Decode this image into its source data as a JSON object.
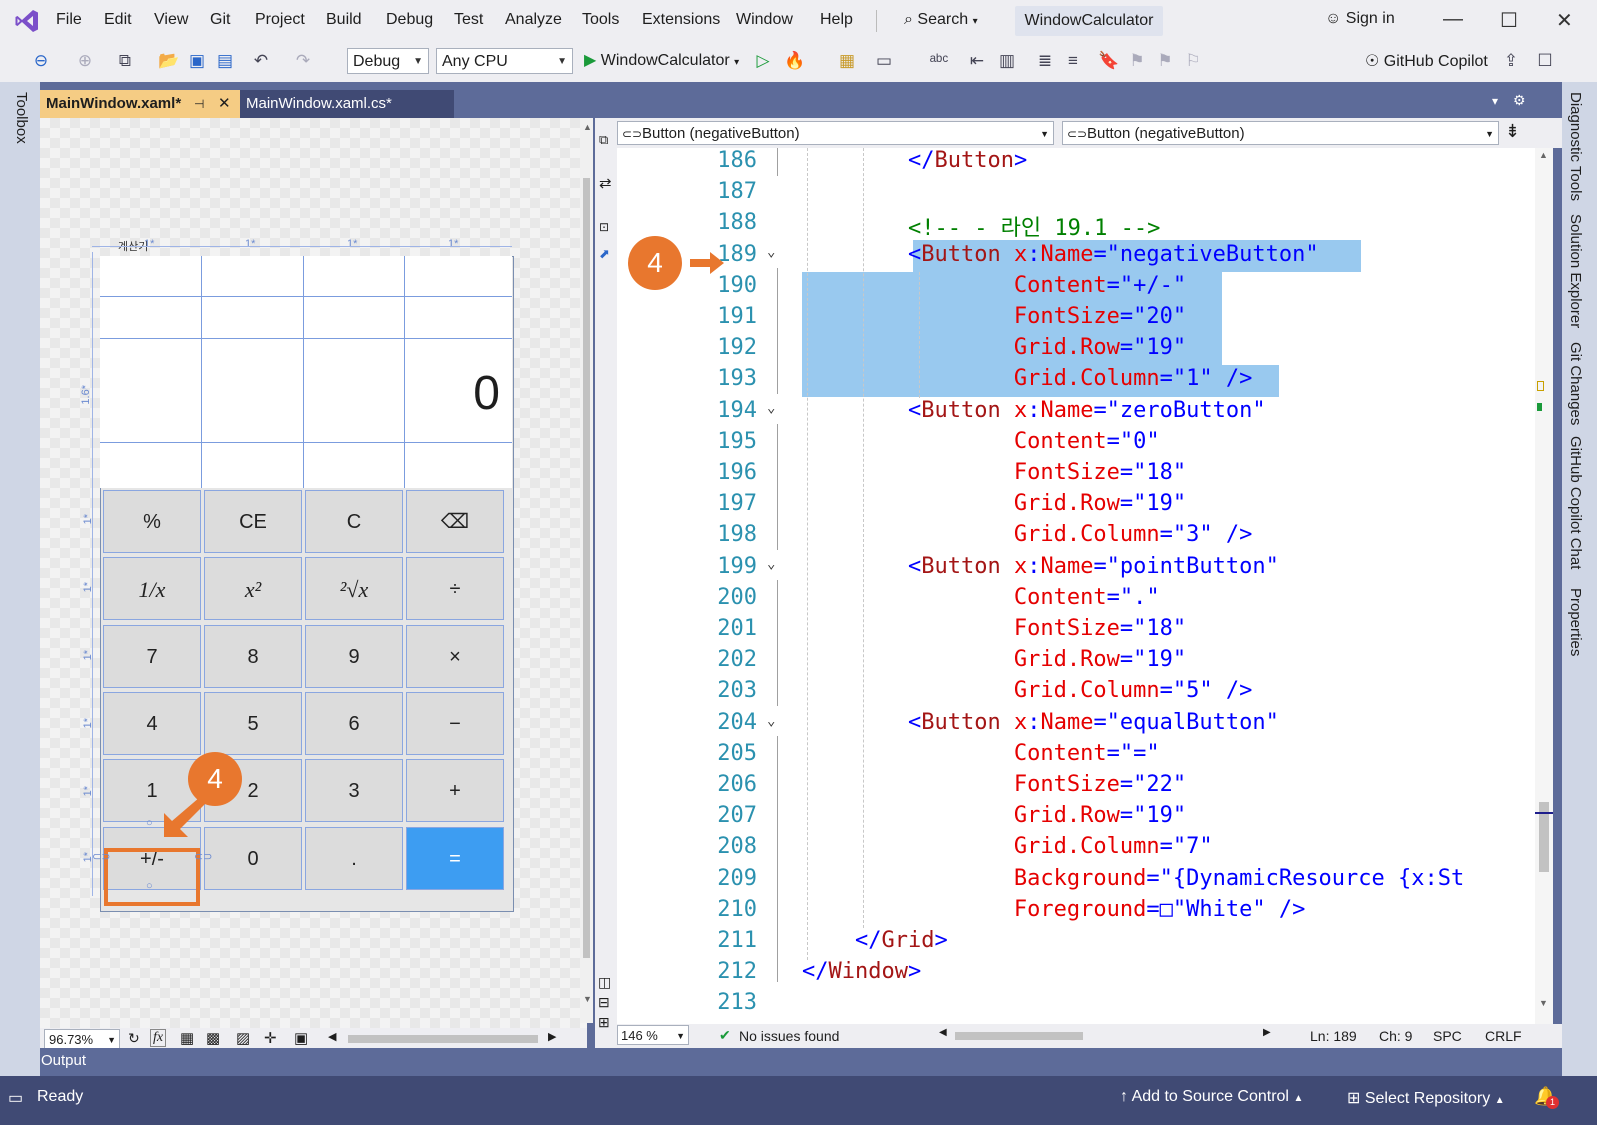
{
  "menu": [
    "File",
    "Edit",
    "View",
    "Git",
    "Project",
    "Build",
    "Debug",
    "Test",
    "Analyze",
    "Tools",
    "Extensions",
    "Window",
    "Help"
  ],
  "search_label": "Search",
  "app_title": "WindowCalculator",
  "sign_in": "Sign in",
  "toolbar": {
    "config": "Debug",
    "platform": "Any CPU",
    "start_target": "WindowCalculator",
    "copilot": "GitHub Copilot"
  },
  "side_tabs": {
    "left": "Toolbox",
    "right": [
      "Diagnostic Tools",
      "Solution Explorer",
      "Git Changes",
      "GitHub Copilot Chat",
      "Properties"
    ]
  },
  "doc_tabs": [
    {
      "label": "MainWindow.xaml*",
      "active": true
    },
    {
      "label": "MainWindow.xaml.cs*",
      "active": false
    }
  ],
  "designer": {
    "window_title": "계산기",
    "col_labels": [
      "1*",
      "1*",
      "1*",
      "1*"
    ],
    "row_labels": [
      "1.6*",
      "1*",
      "1*",
      "1*",
      "1*",
      "1*",
      "1*"
    ],
    "display_value": "0",
    "buttons": [
      [
        "%",
        "CE",
        "C",
        "⌫"
      ],
      [
        "1/x",
        "x²",
        "²√x",
        "÷"
      ],
      [
        "7",
        "8",
        "9",
        "×"
      ],
      [
        "4",
        "5",
        "6",
        "−"
      ],
      [
        "1",
        "2",
        "3",
        "+"
      ],
      [
        "+/-",
        "0",
        ".",
        "="
      ]
    ],
    "zoom": "96.73%",
    "fx_label": "fx"
  },
  "nav_bar": {
    "left": "Button (negativeButton)",
    "right": "Button (negativeButton)"
  },
  "code_lines": [
    {
      "n": "186",
      "parts": [
        [
          "blue",
          "</"
        ],
        [
          "brown",
          "Button"
        ],
        [
          "blue",
          ">"
        ]
      ],
      "indent": "        "
    },
    {
      "n": "187",
      "parts": [],
      "indent": ""
    },
    {
      "n": "188",
      "parts": [
        [
          "green",
          "<!-- - 라인 19.1 -->"
        ]
      ],
      "indent": "        "
    },
    {
      "n": "189",
      "parts": [
        [
          "blue",
          "<"
        ],
        [
          "brown",
          "Button"
        ],
        [
          "red",
          " x"
        ],
        [
          "blue",
          ":"
        ],
        [
          "red",
          "Name"
        ],
        [
          "blue",
          "=\"negativeButton\""
        ]
      ],
      "indent": "        "
    },
    {
      "n": "190",
      "parts": [
        [
          "red",
          "Content"
        ],
        [
          "blue",
          "=\"+/-\""
        ]
      ],
      "indent": "                "
    },
    {
      "n": "191",
      "parts": [
        [
          "red",
          "FontSize"
        ],
        [
          "blue",
          "=\"20\""
        ]
      ],
      "indent": "                "
    },
    {
      "n": "192",
      "parts": [
        [
          "red",
          "Grid.Row"
        ],
        [
          "blue",
          "=\"19\""
        ]
      ],
      "indent": "                "
    },
    {
      "n": "193",
      "parts": [
        [
          "red",
          "Grid.Column"
        ],
        [
          "blue",
          "=\"1\" />"
        ]
      ],
      "indent": "                "
    },
    {
      "n": "194",
      "parts": [
        [
          "blue",
          "<"
        ],
        [
          "brown",
          "Button"
        ],
        [
          "red",
          " x"
        ],
        [
          "blue",
          ":"
        ],
        [
          "red",
          "Name"
        ],
        [
          "blue",
          "=\"zeroButton\""
        ]
      ],
      "indent": "        "
    },
    {
      "n": "195",
      "parts": [
        [
          "red",
          "Content"
        ],
        [
          "blue",
          "=\"0\""
        ]
      ],
      "indent": "                "
    },
    {
      "n": "196",
      "parts": [
        [
          "red",
          "FontSize"
        ],
        [
          "blue",
          "=\"18\""
        ]
      ],
      "indent": "                "
    },
    {
      "n": "197",
      "parts": [
        [
          "red",
          "Grid.Row"
        ],
        [
          "blue",
          "=\"19\""
        ]
      ],
      "indent": "                "
    },
    {
      "n": "198",
      "parts": [
        [
          "red",
          "Grid.Column"
        ],
        [
          "blue",
          "=\"3\" />"
        ]
      ],
      "indent": "                "
    },
    {
      "n": "199",
      "parts": [
        [
          "blue",
          "<"
        ],
        [
          "brown",
          "Button"
        ],
        [
          "red",
          " x"
        ],
        [
          "blue",
          ":"
        ],
        [
          "red",
          "Name"
        ],
        [
          "blue",
          "=\"pointButton\""
        ]
      ],
      "indent": "        "
    },
    {
      "n": "200",
      "parts": [
        [
          "red",
          "Content"
        ],
        [
          "blue",
          "=\".\""
        ]
      ],
      "indent": "                "
    },
    {
      "n": "201",
      "parts": [
        [
          "red",
          "FontSize"
        ],
        [
          "blue",
          "=\"18\""
        ]
      ],
      "indent": "                "
    },
    {
      "n": "202",
      "parts": [
        [
          "red",
          "Grid.Row"
        ],
        [
          "blue",
          "=\"19\""
        ]
      ],
      "indent": "                "
    },
    {
      "n": "203",
      "parts": [
        [
          "red",
          "Grid.Column"
        ],
        [
          "blue",
          "=\"5\" />"
        ]
      ],
      "indent": "                "
    },
    {
      "n": "204",
      "parts": [
        [
          "blue",
          "<"
        ],
        [
          "brown",
          "Button"
        ],
        [
          "red",
          " x"
        ],
        [
          "blue",
          ":"
        ],
        [
          "red",
          "Name"
        ],
        [
          "blue",
          "=\"equalButton\""
        ]
      ],
      "indent": "        "
    },
    {
      "n": "205",
      "parts": [
        [
          "red",
          "Content"
        ],
        [
          "blue",
          "=\"=\""
        ]
      ],
      "indent": "                "
    },
    {
      "n": "206",
      "parts": [
        [
          "red",
          "FontSize"
        ],
        [
          "blue",
          "=\"22\""
        ]
      ],
      "indent": "                "
    },
    {
      "n": "207",
      "parts": [
        [
          "red",
          "Grid.Row"
        ],
        [
          "blue",
          "=\"19\""
        ]
      ],
      "indent": "                "
    },
    {
      "n": "208",
      "parts": [
        [
          "red",
          "Grid.Column"
        ],
        [
          "blue",
          "=\"7\""
        ]
      ],
      "indent": "                "
    },
    {
      "n": "209",
      "parts": [
        [
          "red",
          "Background"
        ],
        [
          "blue",
          "=\"{DynamicResource {x:St"
        ]
      ],
      "indent": "                "
    },
    {
      "n": "210",
      "parts": [
        [
          "red",
          "Foreground"
        ],
        [
          "blue",
          "=□\"White\" />"
        ]
      ],
      "indent": "                "
    },
    {
      "n": "211",
      "parts": [
        [
          "blue",
          "</"
        ],
        [
          "brown",
          "Grid"
        ],
        [
          "blue",
          ">"
        ]
      ],
      "indent": "    "
    },
    {
      "n": "212",
      "parts": [
        [
          "blue",
          "</"
        ],
        [
          "brown",
          "Window"
        ],
        [
          "blue",
          ">"
        ]
      ],
      "indent": ""
    },
    {
      "n": "213",
      "parts": [],
      "indent": ""
    }
  ],
  "editor_status": {
    "zoom": "146 %",
    "issues": "No issues found",
    "line": "Ln: 189",
    "col": "Ch: 9",
    "spc": "SPC",
    "crlf": "CRLF"
  },
  "output_label": "Output",
  "statusbar": {
    "ready": "Ready",
    "source_control": "Add to Source Control",
    "repository": "Select Repository",
    "notifications": "1"
  },
  "annotations": {
    "badge_code": "4",
    "badge_designer": "4"
  },
  "colors": {
    "accent_orange": "#e8772e",
    "selection": "#99c9ef",
    "equals_button": "#3d9df2",
    "statusbar": "#404a74"
  }
}
